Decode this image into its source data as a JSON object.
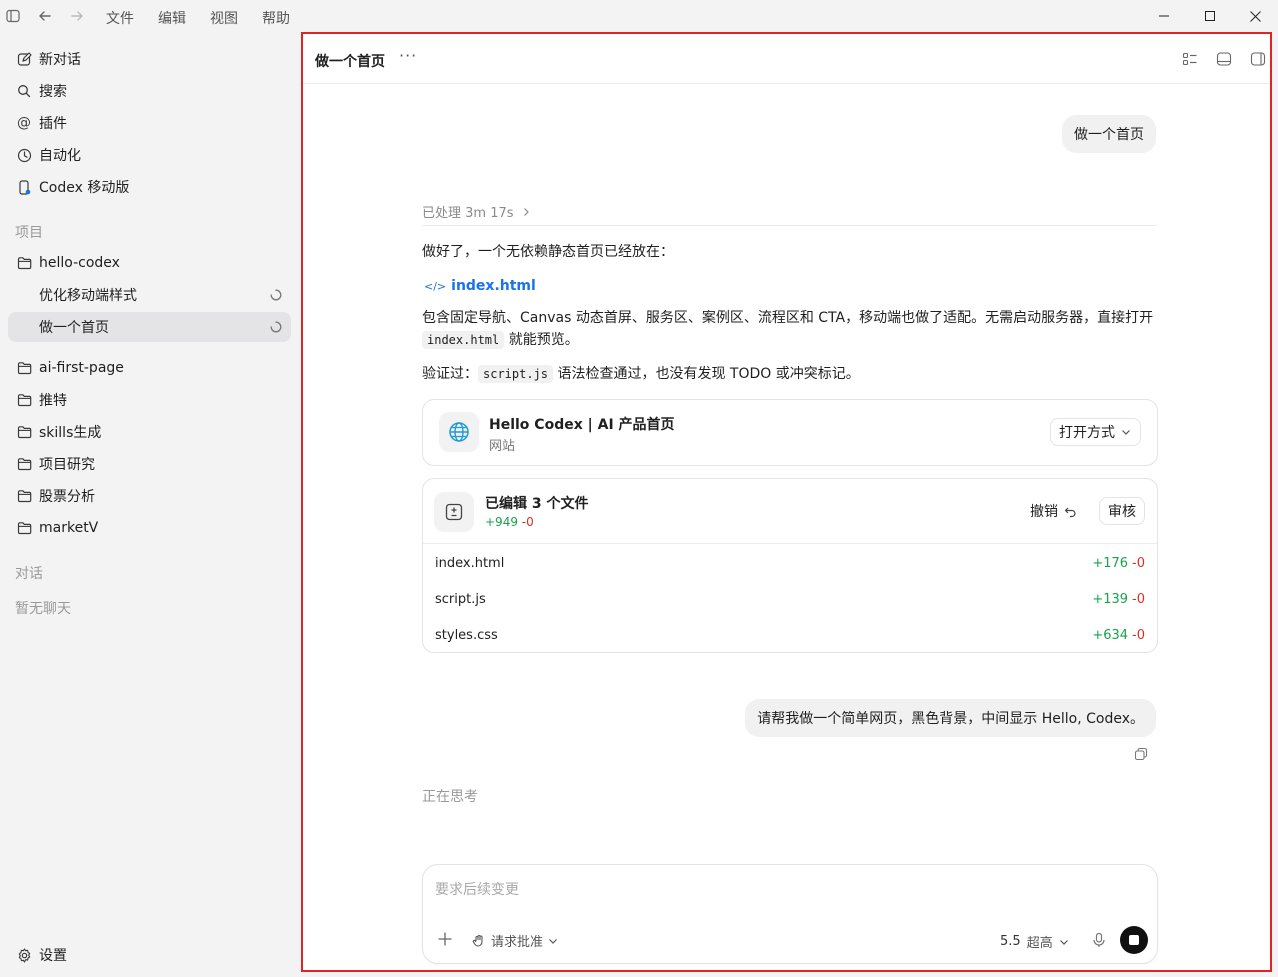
{
  "menubar": {
    "items": [
      "文件",
      "编辑",
      "视图",
      "帮助"
    ]
  },
  "sidebar": {
    "nav": [
      {
        "label": "新对话",
        "icon": "edit-icon"
      },
      {
        "label": "搜索",
        "icon": "search-icon"
      },
      {
        "label": "插件",
        "icon": "at-icon"
      },
      {
        "label": "自动化",
        "icon": "clock-icon"
      },
      {
        "label": "Codex 移动版",
        "icon": "mobile-icon"
      }
    ],
    "projects_label": "项目",
    "projects": [
      "hello-codex",
      "ai-first-page",
      "推特",
      "skills生成",
      "项目研究",
      "股票分析",
      "marketV"
    ],
    "subitems": [
      "优化移动端样式",
      "做一个首页"
    ],
    "chats_label": "对话",
    "no_chats": "暂无聊天",
    "settings": "设置"
  },
  "header": {
    "title": "做一个首页",
    "more": "···"
  },
  "conversation": {
    "user_msg_1": "做一个首页",
    "processed": "已处理 3m 17s",
    "reply_intro": "做好了，一个无依赖静态首页已经放在：",
    "file_link": "index.html",
    "desc_text": "包含固定导航、Canvas 动态首屏、服务区、案例区、流程区和 CTA，移动端也做了适配。无需启动服务器，直接打开",
    "desc_code": "index.html",
    "desc_tail": "就能预览。",
    "verify_label": "验证过：",
    "verify_code": "script.js",
    "verify_text": "语法检查通过，也没有发现 TODO 或冲突标记。",
    "site_card": {
      "title": "Hello Codex | AI 产品首页",
      "subtitle": "网站",
      "open_btn": "打开方式"
    },
    "edit_card": {
      "title": "已编辑 3 个文件",
      "plus": "+949",
      "minus": "-0",
      "undo": "撤销",
      "review": "审核",
      "files": [
        {
          "name": "index.html",
          "plus": "+176",
          "minus": "-0"
        },
        {
          "name": "script.js",
          "plus": "+139",
          "minus": "-0"
        },
        {
          "name": "styles.css",
          "plus": "+634",
          "minus": "-0"
        }
      ]
    },
    "user_msg_2": "请帮我做一个简单网页，黑色背景，中间显示 Hello, Codex。",
    "thinking": "正在思考"
  },
  "composer": {
    "placeholder": "要求后续变更",
    "approval": "请求批准",
    "model": "5.5",
    "effort": "超高"
  }
}
